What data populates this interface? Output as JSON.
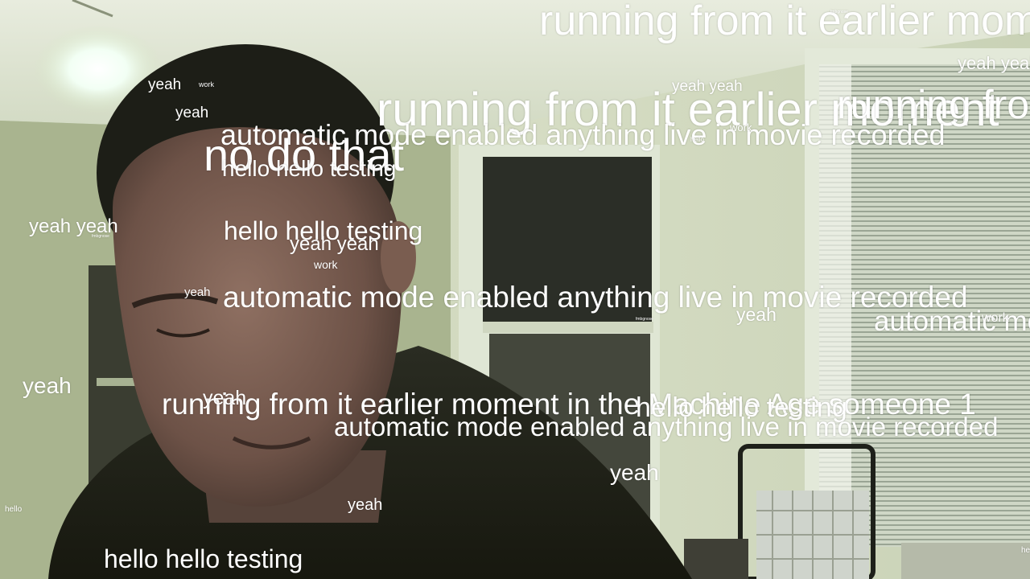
{
  "captions": [
    {
      "id": "c1",
      "text": "running from it earlier moment"
    },
    {
      "id": "c2",
      "text": "yeah yeah"
    },
    {
      "id": "c3",
      "text": "yeah"
    },
    {
      "id": "c4",
      "text": "work"
    },
    {
      "id": "c5",
      "text": "yeah yeah"
    },
    {
      "id": "c6",
      "text": "yeah"
    },
    {
      "id": "c7",
      "text": "running from it earlier moment"
    },
    {
      "id": "c8",
      "text": "running from it"
    },
    {
      "id": "c9",
      "text": "automatic mode enabled anything live in movie recorded"
    },
    {
      "id": "c10",
      "text": "work"
    },
    {
      "id": "c11",
      "text": "hello"
    },
    {
      "id": "c12",
      "text": "no do that"
    },
    {
      "id": "c13",
      "text": "hello hello testing"
    },
    {
      "id": "c14",
      "text": "yeah yeah"
    },
    {
      "id": "c15",
      "text": "hello hello testing"
    },
    {
      "id": "c16",
      "text": "yeah yeah"
    },
    {
      "id": "c17",
      "text": "work"
    },
    {
      "id": "c18",
      "text": "yeah"
    },
    {
      "id": "c19",
      "text": "automatic mode enabled anything live in movie recorded"
    },
    {
      "id": "c20",
      "text": "yeah"
    },
    {
      "id": "c21",
      "text": "automatic mode"
    },
    {
      "id": "c22",
      "text": "work"
    },
    {
      "id": "c23",
      "text": "yeah"
    },
    {
      "id": "c24",
      "text": "running from it earlier moment in the Machine Age someone 1"
    },
    {
      "id": "c25",
      "text": "yeah"
    },
    {
      "id": "c26",
      "text": "hello hello testing"
    },
    {
      "id": "c27",
      "text": "automatic mode enabled anything live in movie recorded"
    },
    {
      "id": "c28",
      "text": "yeah"
    },
    {
      "id": "c29",
      "text": "yeah"
    },
    {
      "id": "c30",
      "text": "hello"
    },
    {
      "id": "c31",
      "text": "hello hello testing"
    },
    {
      "id": "c32",
      "text": "he"
    },
    {
      "id": "c33",
      "text": "fmbgnose"
    },
    {
      "id": "c34",
      "text": "fmbgnose"
    },
    {
      "id": "c35",
      "text": "fmbgnose"
    }
  ]
}
